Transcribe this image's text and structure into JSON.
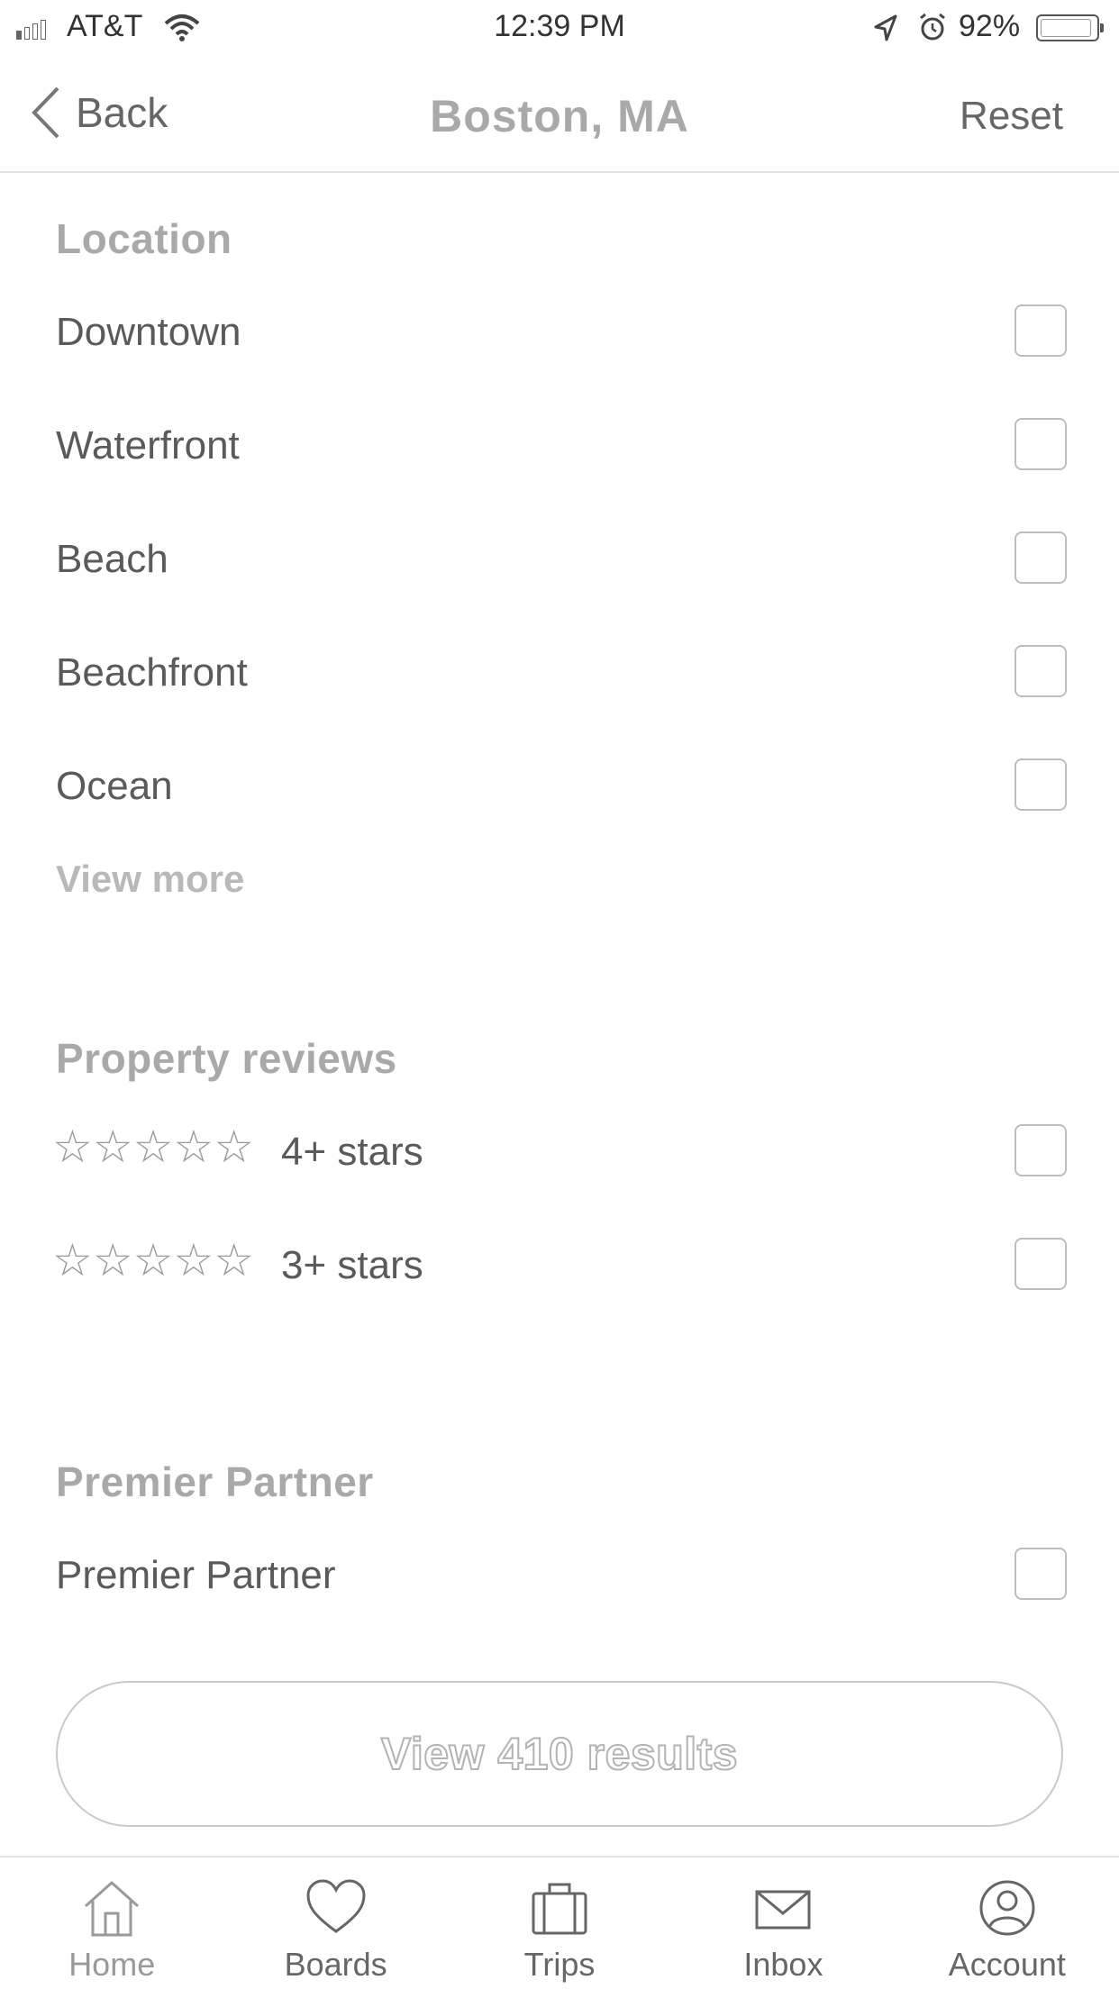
{
  "status_bar": {
    "carrier": "AT&T",
    "time": "12:39 PM",
    "battery": "92%"
  },
  "nav": {
    "back_label": "Back",
    "title": "Boston,  MA",
    "reset_label": "Reset"
  },
  "location": {
    "title": "Location",
    "items": [
      {
        "label": "Downtown",
        "checked": false
      },
      {
        "label": "Waterfront",
        "checked": false
      },
      {
        "label": "Beach",
        "checked": false
      },
      {
        "label": "Beachfront",
        "checked": false
      },
      {
        "label": "Ocean",
        "checked": false
      }
    ],
    "view_more": "View more"
  },
  "reviews": {
    "title": "Property reviews",
    "items": [
      {
        "label": "4+ stars",
        "stars": "☆☆☆☆☆",
        "checked": false
      },
      {
        "label": "3+ stars",
        "stars": "☆☆☆☆☆",
        "checked": false
      }
    ]
  },
  "premier": {
    "title": "Premier Partner",
    "items": [
      {
        "label": "Premier Partner",
        "checked": false
      }
    ]
  },
  "results_button": "View 410 results",
  "tabs": [
    {
      "label": "Home",
      "icon": "home-icon"
    },
    {
      "label": "Boards",
      "icon": "heart-icon"
    },
    {
      "label": "Trips",
      "icon": "suitcase-icon"
    },
    {
      "label": "Inbox",
      "icon": "envelope-icon"
    },
    {
      "label": "Account",
      "icon": "user-icon"
    }
  ],
  "colors": {
    "heading": "#a9a9a9",
    "text": "#5a5a5a",
    "border": "#bdbdbd"
  }
}
